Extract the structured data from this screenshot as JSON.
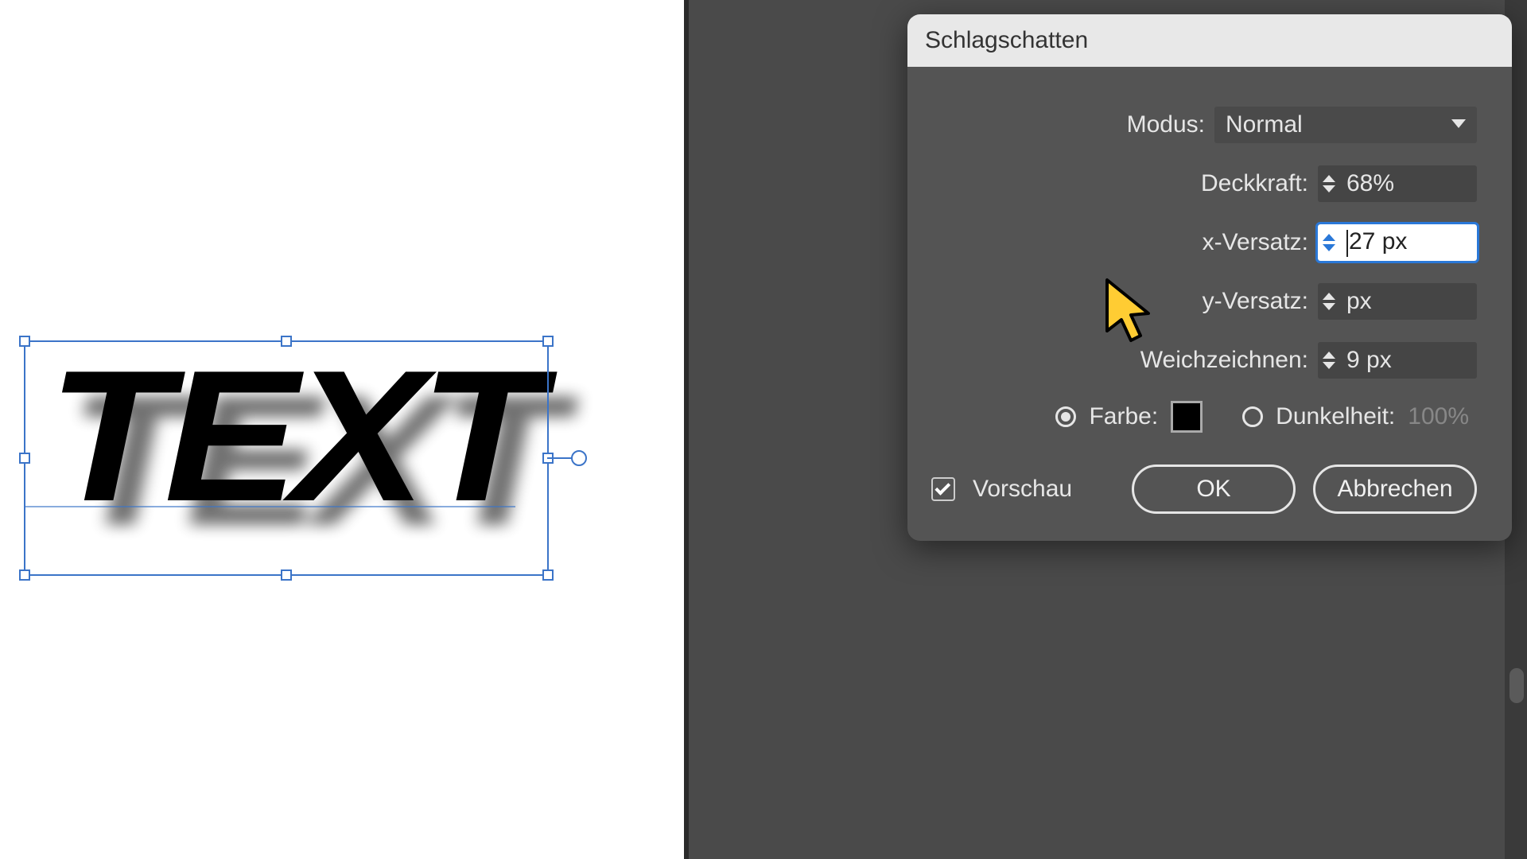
{
  "canvas": {
    "text": "TEXT"
  },
  "dialog": {
    "title": "Schlagschatten",
    "mode_label": "Modus:",
    "mode_value": "Normal",
    "opacity_label": "Deckkraft:",
    "opacity_value": "68%",
    "xoffset_label": "x-Versatz:",
    "xoffset_value": "27 px",
    "yoffset_label": "y-Versatz:",
    "yoffset_value_suffix": " px",
    "blur_label": "Weichzeichnen:",
    "blur_value": "9 px",
    "color_label": "Farbe:",
    "color_value": "#000000",
    "darkness_label": "Dunkelheit:",
    "darkness_value": "100%",
    "preview_label": "Vorschau",
    "ok_label": "OK",
    "cancel_label": "Abbrechen"
  }
}
